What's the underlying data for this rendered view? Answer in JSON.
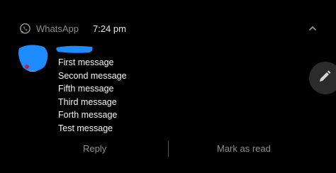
{
  "notification": {
    "app_name": "WhatsApp",
    "time": "7:24 pm",
    "messages": [
      "First message",
      "Second message",
      "Fifth message",
      "Third message",
      "Forth message",
      "Test message"
    ]
  },
  "actions": {
    "reply_label": "Reply",
    "mark_read_label": "Mark as read"
  },
  "icons": {
    "app": "whatsapp-icon",
    "collapse": "chevron-up-icon",
    "edit": "pencil-icon"
  },
  "colors": {
    "background": "#000000",
    "redaction": "#1e8cff",
    "muted_text": "#8f8f8f"
  }
}
